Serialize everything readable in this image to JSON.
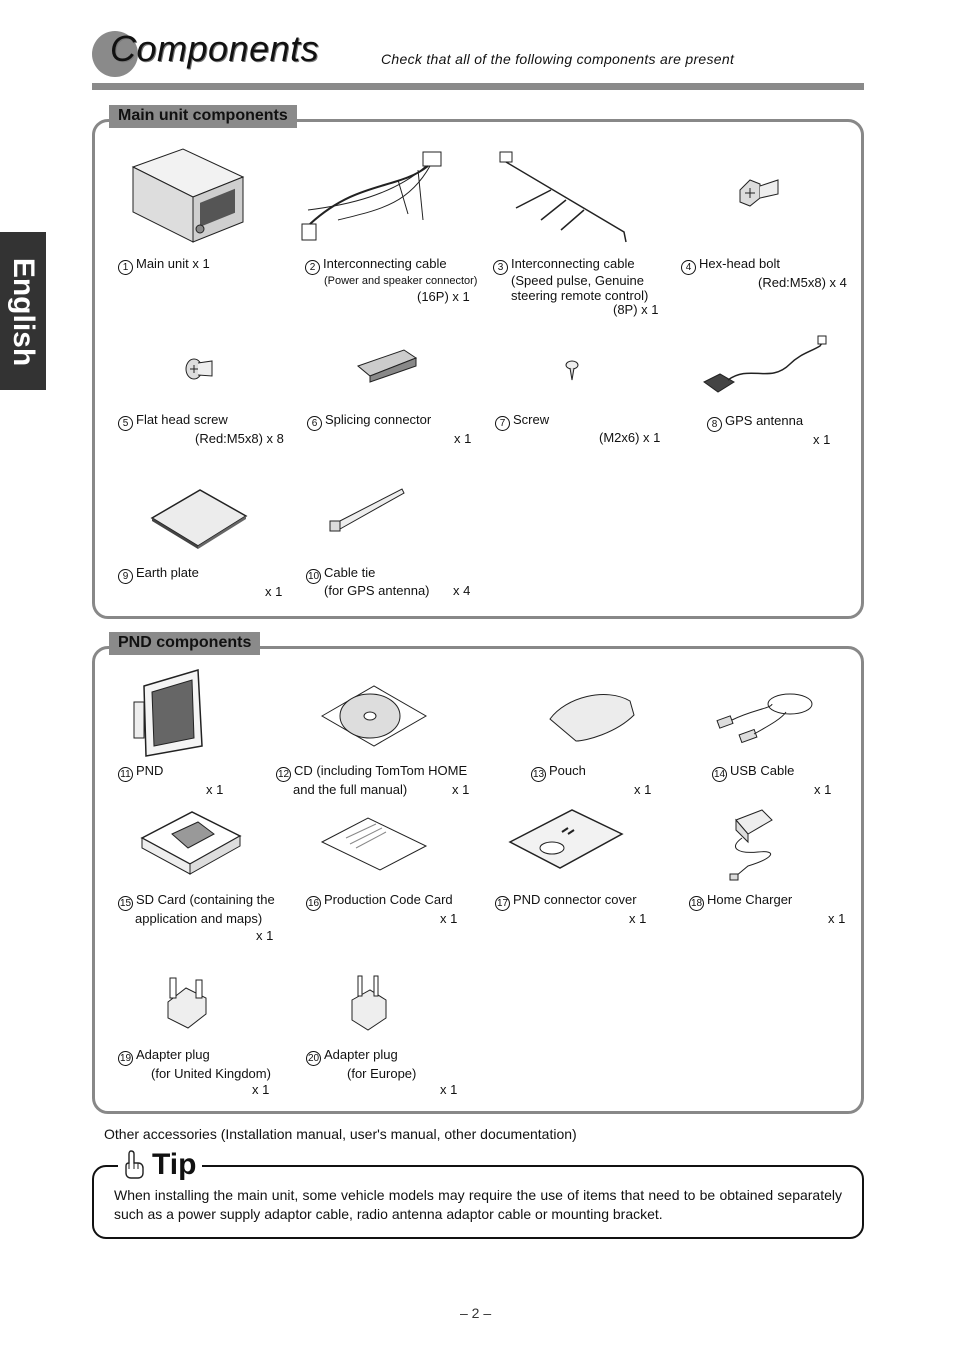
{
  "header": {
    "title": "Components",
    "subtitle": "Check that all of the following components are present"
  },
  "language_tab": "English",
  "main_unit_section": {
    "label": "Main unit components",
    "items": [
      {
        "num": "1",
        "name": "Main unit  x 1",
        "lines": []
      },
      {
        "num": "2",
        "name": "Interconnecting cable",
        "lines": [
          "(Power and speaker connector)",
          "(16P) x 1"
        ]
      },
      {
        "num": "3",
        "name": "Interconnecting cable",
        "lines": [
          "(Speed pulse, Genuine",
          "steering remote control)",
          "(8P) x 1"
        ]
      },
      {
        "num": "4",
        "name": "Hex-head bolt",
        "lines": [
          "(Red:M5x8) x 4"
        ]
      },
      {
        "num": "5",
        "name": "Flat head screw",
        "lines": [
          "(Red:M5x8) x 8"
        ]
      },
      {
        "num": "6",
        "name": "Splicing connector",
        "lines": [
          "x 1"
        ]
      },
      {
        "num": "7",
        "name": "Screw",
        "lines": [
          "(M2x6) x 1"
        ]
      },
      {
        "num": "8",
        "name": "GPS antenna",
        "lines": [
          "x 1"
        ]
      },
      {
        "num": "9",
        "name": "Earth plate",
        "lines": [
          "x 1"
        ]
      },
      {
        "num": "10",
        "name": "Cable tie",
        "lines": [
          "(for GPS antenna)",
          "x 4"
        ]
      }
    ]
  },
  "pnd_section": {
    "label": "PND components",
    "items": [
      {
        "num": "11",
        "name": "PND",
        "lines": [
          "x 1"
        ]
      },
      {
        "num": "12",
        "name": "CD (including TomTom HOME",
        "lines": [
          "and the full manual)",
          "x 1"
        ]
      },
      {
        "num": "13",
        "name": "Pouch",
        "lines": [
          "x 1"
        ]
      },
      {
        "num": "14",
        "name": "USB Cable",
        "lines": [
          "x 1"
        ]
      },
      {
        "num": "15",
        "name": "SD Card (containing the",
        "lines": [
          "application and maps)",
          "x 1"
        ]
      },
      {
        "num": "16",
        "name": "Production Code Card",
        "lines": [
          "x 1"
        ]
      },
      {
        "num": "17",
        "name": "PND connector cover",
        "lines": [
          "x 1"
        ]
      },
      {
        "num": "18",
        "name": "Home Charger",
        "lines": [
          "x 1"
        ]
      },
      {
        "num": "19",
        "name": "Adapter plug",
        "lines": [
          "(for United Kingdom)",
          "x 1"
        ]
      },
      {
        "num": "20",
        "name": "Adapter plug",
        "lines": [
          "(for Europe)",
          "x 1"
        ]
      }
    ]
  },
  "other_accessories": "Other accessories (Installation manual, user's manual, other documentation)",
  "tip": {
    "title": "Tip",
    "icon": "pointing-hand-icon",
    "text": "When installing the main unit, some vehicle models may require the use of items that need to be obtained separately such as a power supply adaptor cable, radio antenna adaptor cable or mounting bracket."
  },
  "page_number": "– 2 –"
}
